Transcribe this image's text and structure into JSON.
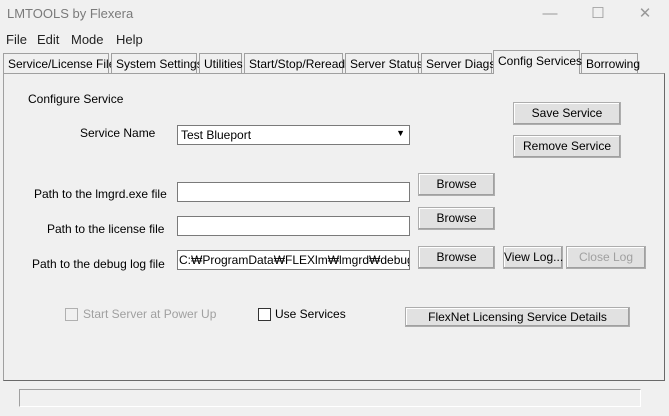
{
  "window": {
    "title": "LMTOOLS by Flexera",
    "minimize": "—",
    "maximize": "☐",
    "close": "✕"
  },
  "menu": [
    "File",
    "Edit",
    "Mode",
    "Help"
  ],
  "tabs": [
    "Service/License File",
    "System Settings",
    "Utilities",
    "Start/Stop/Reread",
    "Server Status",
    "Server Diags",
    "Config Services",
    "Borrowing"
  ],
  "form": {
    "section": "Configure Service",
    "service_name_label": "Service Name",
    "service_name_value": "Test Blueport",
    "lmgrd_label": "Path to the lmgrd.exe file",
    "lmgrd_value": "",
    "license_label": "Path to the license file",
    "license_value": "",
    "debug_label": "Path to the debug log file",
    "debug_value": "C:₩ProgramData₩FLEXlm₩lmgrd₩debug.log",
    "browse": "Browse",
    "save": "Save Service",
    "remove": "Remove Service",
    "view_log": "View Log...",
    "close_log": "Close Log",
    "start_power_up": "Start Server at Power Up",
    "use_services": "Use Services",
    "flexnet_details": "FlexNet Licensing Service Details"
  }
}
